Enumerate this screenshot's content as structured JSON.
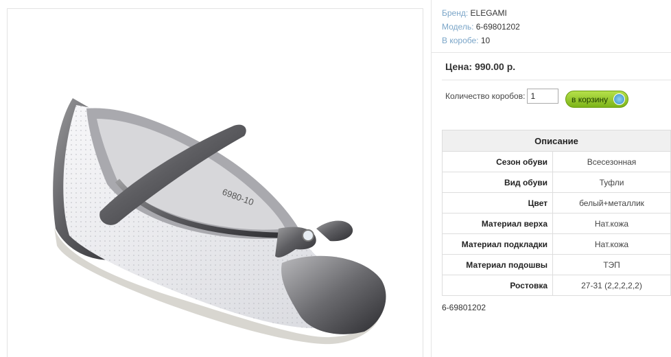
{
  "meta": {
    "brand_label": "Бренд:",
    "brand_value": "ELEGAMI",
    "model_label": "Модель:",
    "model_value": "6-69801202",
    "box_label": "В коробе:",
    "box_value": "10"
  },
  "price": "Цена: 990.00 р.",
  "quantity": {
    "label": "Количество коробов:",
    "value": "1"
  },
  "cart_button": {
    "label": "в корзину",
    "icon": "basket-icon"
  },
  "description": {
    "header": "Описание",
    "rows": [
      {
        "key": "Сезон обуви",
        "value": "Всесезонная"
      },
      {
        "key": "Вид обуви",
        "value": "Туфли"
      },
      {
        "key": "Цвет",
        "value": "белый+металлик"
      },
      {
        "key": "Материал верха",
        "value": "Нат.кожа"
      },
      {
        "key": "Материал подкладки",
        "value": "Нат.кожа"
      },
      {
        "key": "Материал подошвы",
        "value": "ТЭП"
      },
      {
        "key": "Ростовка",
        "value": "27-31 (2,2,2,2,2)"
      }
    ]
  },
  "article_code": "6-69801202",
  "insole_print": "6980-10"
}
